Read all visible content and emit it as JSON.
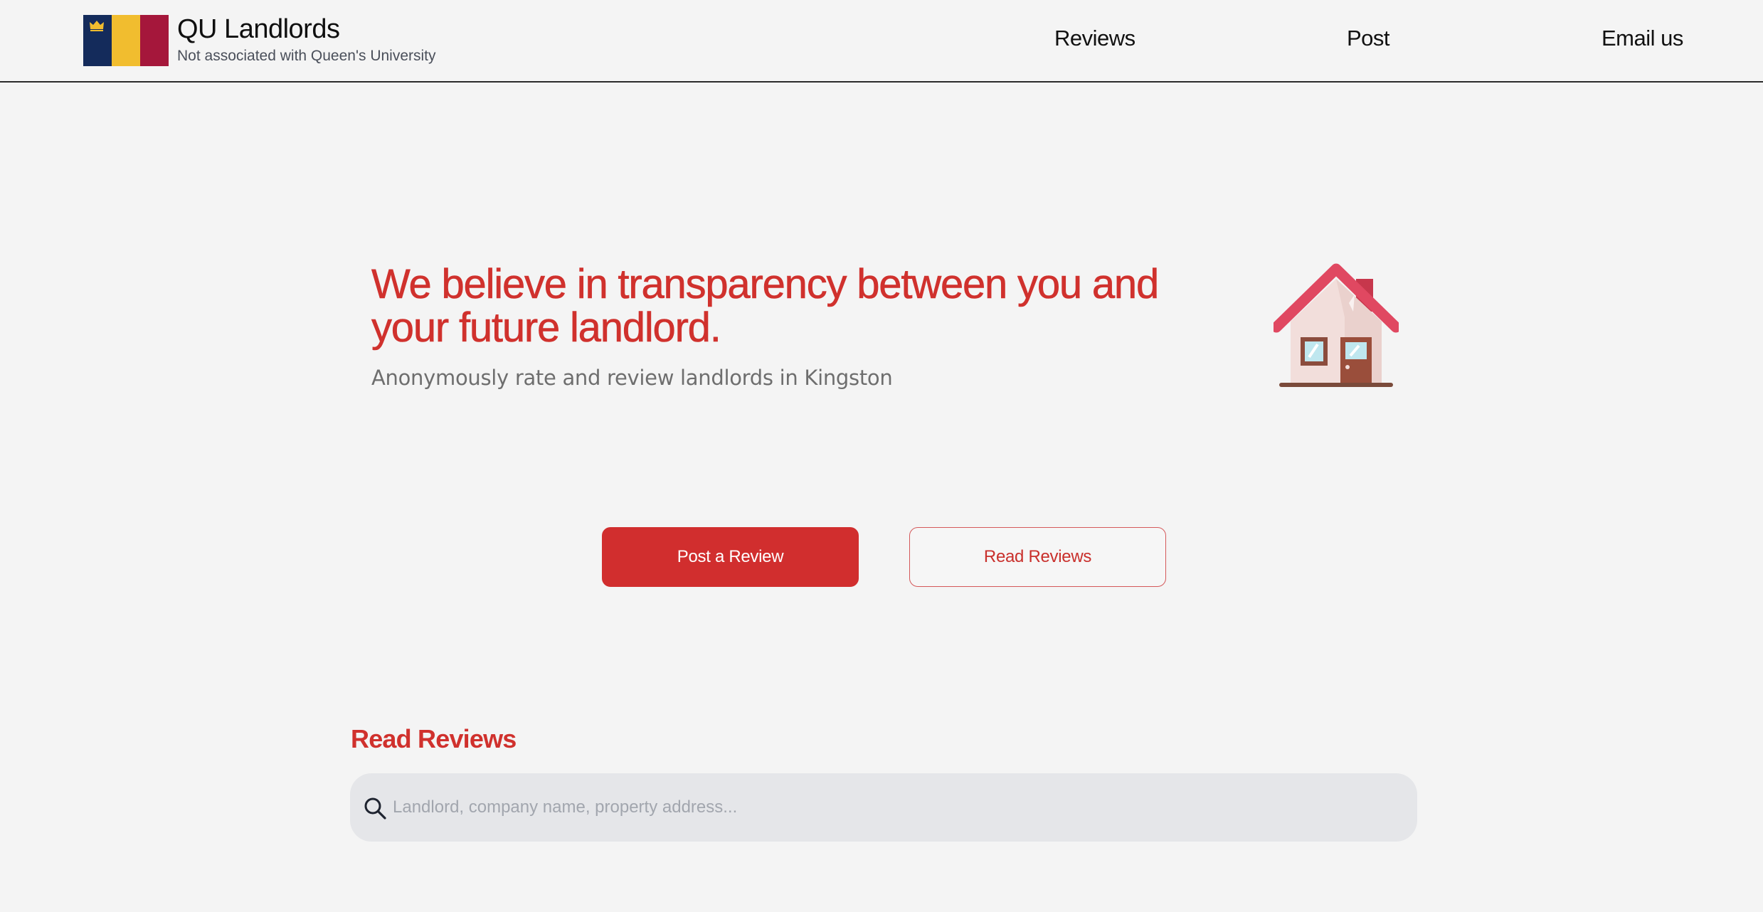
{
  "header": {
    "brand_title": "QU Landlords",
    "brand_subtitle": "Not associated with Queen's University",
    "logo_colors": [
      "#142b5b",
      "#f1bd2f",
      "#a5173b"
    ],
    "nav": {
      "reviews": "Reviews",
      "post": "Post",
      "email": "Email us"
    }
  },
  "hero": {
    "heading": "We believe in transparency between you and your future landlord.",
    "subheading": "Anonymously rate and review landlords in Kingston",
    "icon": "house-icon"
  },
  "actions": {
    "post_review": "Post a Review",
    "read_reviews": "Read Reviews"
  },
  "reviews_section": {
    "title": "Read Reviews",
    "search_placeholder": "Landlord, company name, property address..."
  },
  "colors": {
    "accent_red": "#d12e2e",
    "background": "#f4f4f4",
    "search_bg": "#e5e6e9"
  }
}
